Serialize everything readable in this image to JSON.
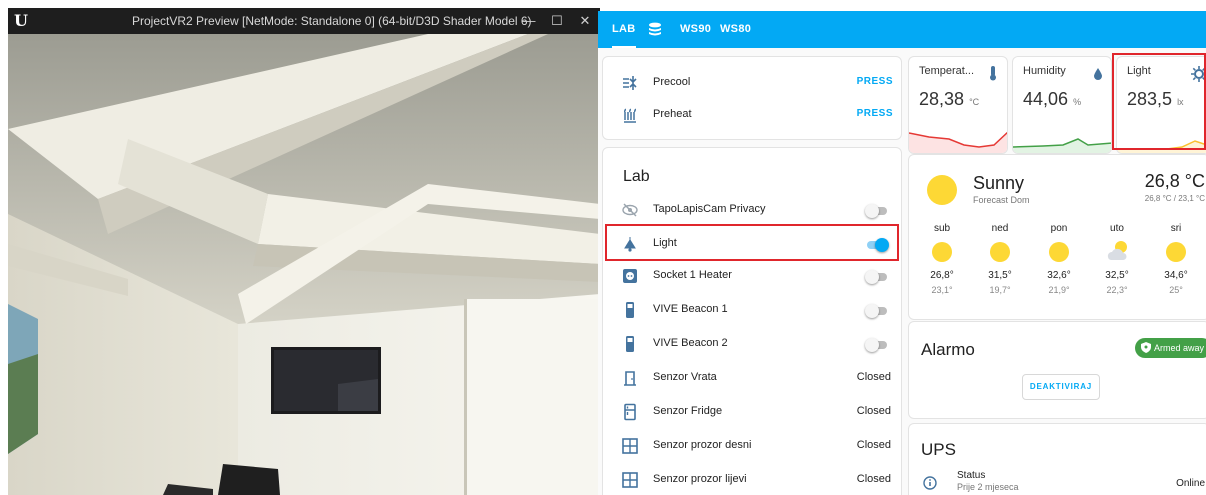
{
  "ue": {
    "logo": "U",
    "title": "ProjectVR2 Preview [NetMode: Standalone 0]  (64-bit/D3D Shader Model 6)",
    "minimize": "—",
    "maximize": "☐",
    "close": "✕"
  },
  "ha": {
    "tabs": [
      "LAB",
      "WS90",
      "WS80"
    ],
    "buttons": [
      {
        "label": "Precool",
        "action": "PRESS",
        "icon": "air-conditioner-icon"
      },
      {
        "label": "Preheat",
        "action": "PRESS",
        "icon": "radiator-icon"
      }
    ],
    "lab": {
      "title": "Lab",
      "items": [
        {
          "label": "TapoLapisCam Privacy",
          "state": "off",
          "icon": "eye-off-icon"
        },
        {
          "label": "Light",
          "state": "on",
          "icon": "ceiling-light-icon"
        },
        {
          "label": "Socket 1 Heater",
          "state": "off",
          "icon": "power-socket-icon"
        },
        {
          "label": "VIVE Beacon 1",
          "state": "off",
          "icon": "beacon-icon"
        },
        {
          "label": "VIVE Beacon 2",
          "state": "off",
          "icon": "beacon-icon"
        },
        {
          "label": "Senzor Vrata",
          "value": "Closed",
          "icon": "door-icon"
        },
        {
          "label": "Senzor Fridge",
          "value": "Closed",
          "icon": "fridge-icon"
        },
        {
          "label": "Senzor prozor desni",
          "value": "Closed",
          "icon": "window-icon"
        },
        {
          "label": "Senzor prozor lijevi",
          "value": "Closed",
          "icon": "window-icon"
        }
      ]
    },
    "sensors": [
      {
        "name": "Temperat...",
        "value": "28,38",
        "unit": "°C",
        "icon": "thermometer-icon",
        "color": "#e53935"
      },
      {
        "name": "Humidity",
        "value": "44,06",
        "unit": "%",
        "icon": "water-drop-icon",
        "color": "#43a047"
      },
      {
        "name": "Light",
        "value": "283,5",
        "unit": "lx",
        "icon": "brightness-icon",
        "color": "#fbc02d"
      }
    ],
    "weather": {
      "condition": "Sunny",
      "location": "Forecast Dom",
      "temp": "26,8 °C",
      "range": "26,8 °C / 23,1 °C",
      "days": [
        {
          "day": "sub",
          "hi": "26,8°",
          "lo": "23,1°",
          "icon": "sunny"
        },
        {
          "day": "ned",
          "hi": "31,5°",
          "lo": "19,7°",
          "icon": "sunny"
        },
        {
          "day": "pon",
          "hi": "32,6°",
          "lo": "21,9°",
          "icon": "sunny"
        },
        {
          "day": "uto",
          "hi": "32,5°",
          "lo": "22,3°",
          "icon": "partly-cloudy"
        },
        {
          "day": "sri",
          "hi": "34,6°",
          "lo": "25°",
          "icon": "sunny"
        }
      ]
    },
    "alarmo": {
      "title": "Alarmo",
      "badge": "Armed away",
      "button": "DEAKTIVIRAJ",
      "badge_color": "#43a047"
    },
    "ups": {
      "title": "UPS",
      "status_label": "Status",
      "status_sub": "Prije 2 mjeseca",
      "status_value": "Online"
    }
  }
}
